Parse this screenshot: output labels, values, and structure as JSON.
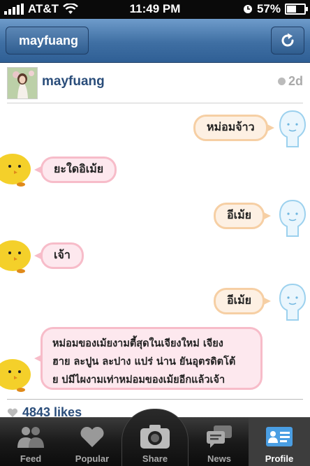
{
  "status_bar": {
    "carrier": "AT&T",
    "time": "11:49 PM",
    "battery_percent": "57%",
    "battery_level": 0.57
  },
  "nav": {
    "back_label": "mayfuang",
    "refresh_icon": "refresh-icon"
  },
  "post": {
    "username": "mayfuang",
    "age": "2d",
    "likes": "4843 likes"
  },
  "chat": {
    "m1": "หม่อมจ้าว",
    "m2": "ยะใดอิเม้ย",
    "m3": "อีเม้ย",
    "m4": "เจ้า",
    "m5": "อีเม้ย",
    "m6_lines": [
      "หม่อมของเม้ยงามตี้สุดในเจียงใหม่ เจียง",
      "ฮาย ละปูน ละปาง แปร่ น่าน ยันอุตรดิตโต้",
      "ย บ่มีไผงามเท่าหม่อมของเม้ยอีกแล้วเจ้า"
    ]
  },
  "tabs": [
    {
      "label": "Feed",
      "icon": "people-icon"
    },
    {
      "label": "Popular",
      "icon": "heart-icon"
    },
    {
      "label": "Share",
      "icon": "camera-icon"
    },
    {
      "label": "News",
      "icon": "speech-bubbles-icon"
    },
    {
      "label": "Profile",
      "icon": "id-card-icon"
    }
  ]
}
